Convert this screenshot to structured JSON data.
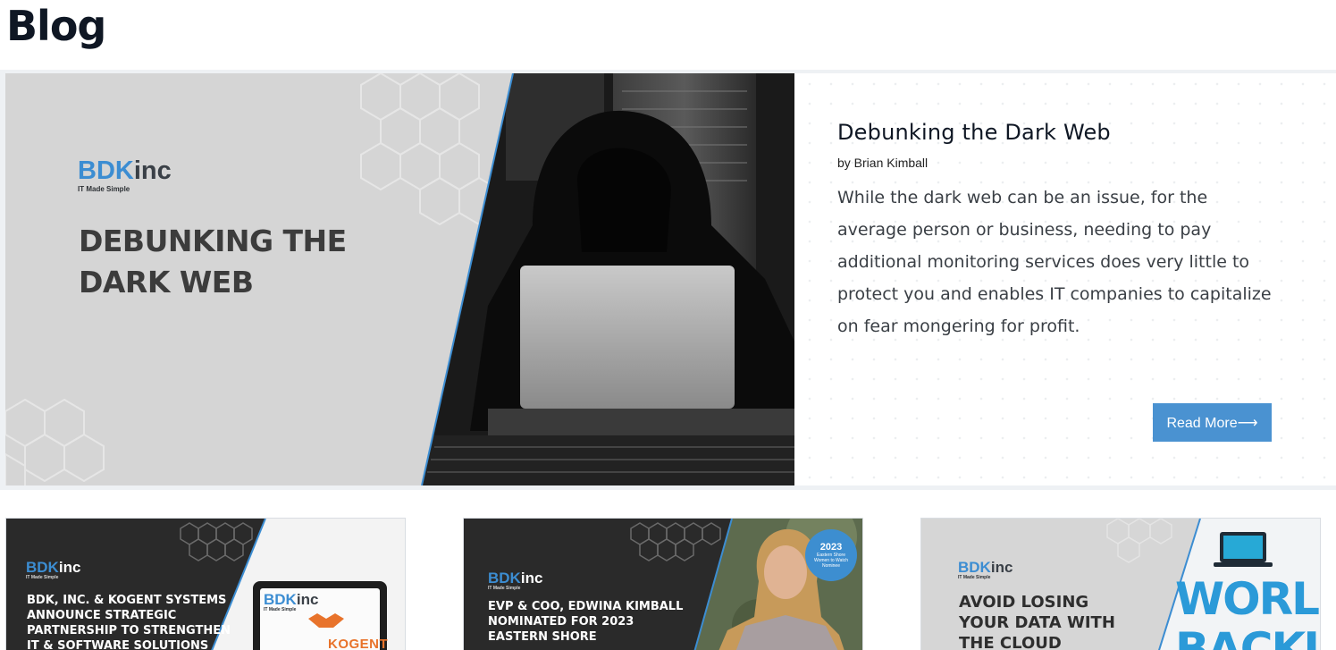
{
  "page": {
    "title": "Blog"
  },
  "featured": {
    "image": {
      "brand_bdk": "BDK",
      "brand_inc": "inc",
      "brand_tagline": "IT Made Simple",
      "headline": "DEBUNKING THE DARK WEB"
    },
    "title": "Debunking the Dark Web",
    "byline": "by Brian Kimball",
    "excerpt": "While the dark web can be an issue, for the average person or business, needing to pay additional monitoring services does very little to protect you and enables IT companies to capitalize on fear mongering for profit.",
    "read_more_label": "Read More⟶"
  },
  "cards": [
    {
      "brand_bdk": "BDK",
      "brand_inc": "inc",
      "brand_tagline": "IT Made Simple",
      "headline": "BDK, INC. & KOGENT SYSTEMS ANNOUNCE STRATEGIC PARTNERSHIP TO STRENGTHEN IT & SOFTWARE SOLUTIONS",
      "tablet_brand_bdk": "BDK",
      "tablet_brand_inc": "inc",
      "tablet_brand_tagline": "IT Made Simple",
      "partner_logo": "KOGENT"
    },
    {
      "brand_bdk": "BDK",
      "brand_inc": "inc",
      "brand_tagline": "IT Made Simple",
      "headline": "EVP & COO, EDWINA KIMBALL NOMINATED FOR 2023 EASTERN SHORE",
      "badge_year": "2023",
      "badge_text": "Eastern Shore Women to Watch Nominee"
    },
    {
      "brand_bdk": "BDK",
      "brand_inc": "inc",
      "brand_tagline": "IT Made Simple",
      "headline": "AVOID LOSING YOUR DATA WITH THE CLOUD",
      "graphic_text": "WORLD BACKUP"
    }
  ],
  "colors": {
    "accent": "#4a92d1",
    "brand_blue": "#3c8dd2",
    "title": "#0f1724",
    "card_dark": "#2a2a2a"
  }
}
